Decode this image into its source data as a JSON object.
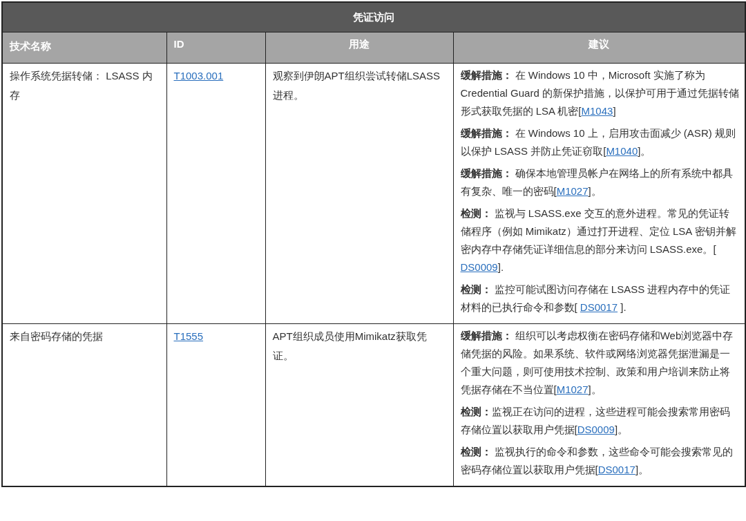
{
  "table": {
    "title": "凭证访问",
    "columns": [
      "技术名称",
      "ID",
      "用途",
      "建议"
    ],
    "rows": [
      {
        "name": "操作系统凭据转储： LSASS 内存",
        "id": "T1003.001",
        "usage": "观察到伊朗APT组织尝试转储LSASS进程。",
        "advice": [
          {
            "label": "缓解措施：",
            "text": " 在 Windows 10 中，Microsoft 实施了称为 Credential Guard 的新保护措施，以保护可用于通过凭据转储形式获取凭据的 LSA 机密[",
            "link": "M1043",
            "after": "]"
          },
          {
            "label": "缓解措施：",
            "text": " 在 Windows 10 上，启用攻击面减少 (ASR) 规则以保护 LSASS 并防止凭证窃取[",
            "link": "M1040",
            "after": "]。"
          },
          {
            "label": "缓解措施：",
            "text": " 确保本地管理员帐户在网络上的所有系统中都具有复杂、唯一的密码[",
            "link": "M1027",
            "after": "]。"
          },
          {
            "label": "检测：",
            "text": " 监视与 LSASS.exe 交互的意外进程。常见的凭证转储程序（例如 Mimikatz）通过打开进程、定位 LSA 密钥并解密内存中存储凭证详细信息的部分来访问 LSASS.exe。[ ",
            "link": "DS0009",
            "after": "]."
          },
          {
            "label": "检测：",
            "text": " 监控可能试图访问存储在 LSASS 进程内存中的凭证材料的已执行命令和参数[ ",
            "link": "DS0017",
            "after": " ]."
          }
        ]
      },
      {
        "name": "来自密码存储的凭据",
        "id": "T1555",
        "usage": "APT组织成员使用Mimikatz获取凭证。",
        "advice": [
          {
            "label": "缓解措施：",
            "text": " 组织可以考虑权衡在密码存储和Web浏览器中存储凭据的风险。如果系统、软件或网络浏览器凭据泄漏是一个重大问题，则可使用技术控制、政策和用户培训来防止将凭据存储在不当位置[",
            "link": "M1027",
            "after": "]。"
          },
          {
            "label": "检测：",
            "text": "监视正在访问的进程，这些进程可能会搜索常用密码存储位置以获取用户凭据[",
            "link": "DS0009",
            "after": "]。"
          },
          {
            "label": "检测：",
            "text": " 监视执行的命令和参数，这些命令可能会搜索常见的密码存储位置以获取用户凭据[",
            "link": "DS0017",
            "after": "]。"
          }
        ]
      }
    ]
  }
}
